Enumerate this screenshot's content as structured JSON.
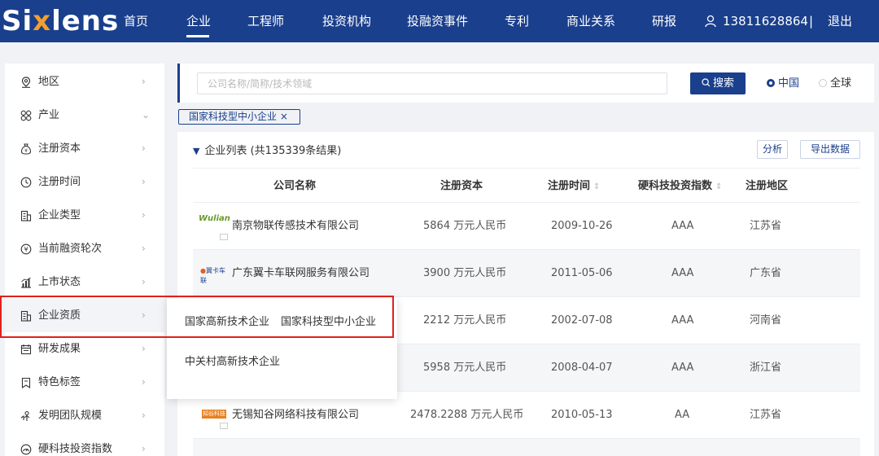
{
  "header": {
    "logo_text": [
      "Si",
      "x",
      "lens"
    ],
    "nav": [
      "首页",
      "企业",
      "工程师",
      "投资机构",
      "投融资事件",
      "专利",
      "商业关系",
      "研报"
    ],
    "active_nav": "企业",
    "user_phone": "13811628864",
    "separator": "|",
    "logout": "退出"
  },
  "sidebar": {
    "items": [
      {
        "label": "地区",
        "icon": "location-icon",
        "chevron": "›"
      },
      {
        "label": "产业",
        "icon": "industry-icon",
        "chevron": "⌄"
      },
      {
        "label": "注册资本",
        "icon": "money-bag-icon",
        "chevron": "›"
      },
      {
        "label": "注册时间",
        "icon": "clock-icon",
        "chevron": "›"
      },
      {
        "label": "企业类型",
        "icon": "building-icon",
        "chevron": "›"
      },
      {
        "label": "当前融资轮次",
        "icon": "financing-icon",
        "chevron": "›"
      },
      {
        "label": "上市状态",
        "icon": "chart-bar-icon",
        "chevron": "›"
      },
      {
        "label": "企业资质",
        "icon": "building-icon",
        "chevron": "›"
      },
      {
        "label": "研发成果",
        "icon": "calendar-icon",
        "chevron": "›"
      },
      {
        "label": "特色标签",
        "icon": "bookmark-icon",
        "chevron": "›"
      },
      {
        "label": "发明团队规模",
        "icon": "team-icon",
        "chevron": "›"
      },
      {
        "label": "硬科技投资指数",
        "icon": "gauge-icon",
        "chevron": "›"
      }
    ]
  },
  "search": {
    "placeholder": "公司名称/简称/技术领域",
    "button": "搜索",
    "search_icon": "search-icon",
    "scope_options": [
      "中国",
      "全球"
    ],
    "scope_selected": "中国"
  },
  "filter_tag": "国家科技型中小企业 ×",
  "list": {
    "title": "企业列表 (共135339条结果)",
    "analyze_button": "分析",
    "export_button": "导出数据",
    "columns": [
      "公司名称",
      "注册资本",
      "注册时间",
      "硬科技投资指数",
      "注册地区"
    ],
    "sortable": [
      "注册时间",
      "硬科技投资指数"
    ],
    "rows": [
      {
        "logo": "Wulian",
        "name": "南京物联传感技术有限公司",
        "capital": "5864 万元人民币",
        "date": "2009-10-26",
        "index": "AAA",
        "region": "江苏省"
      },
      {
        "logo": "翼卡车联",
        "name": "广东翼卡车联网服务有限公司",
        "capital": "3900 万元人民币",
        "date": "2011-05-06",
        "index": "AAA",
        "region": "广东省"
      },
      {
        "logo": "",
        "name": "",
        "capital": "2212 万元人民币",
        "date": "2002-07-08",
        "index": "AAA",
        "region": "河南省"
      },
      {
        "logo": "",
        "name": "",
        "capital": "5958 万元人民币",
        "date": "2008-04-07",
        "index": "AAA",
        "region": "浙江省"
      },
      {
        "logo": "知谷科技",
        "name": "无锡知谷网络科技有限公司",
        "capital": "2478.2288 万元人民币",
        "date": "2010-05-13",
        "index": "AA",
        "region": "江苏省"
      }
    ]
  },
  "popup": {
    "options": [
      "国家高新技术企业",
      "国家科技型中小企业",
      "中关村高新技术企业"
    ]
  },
  "colors": {
    "brand": "#1a3f8c",
    "accent": "#f0a030",
    "highlight": "#e0201c"
  }
}
